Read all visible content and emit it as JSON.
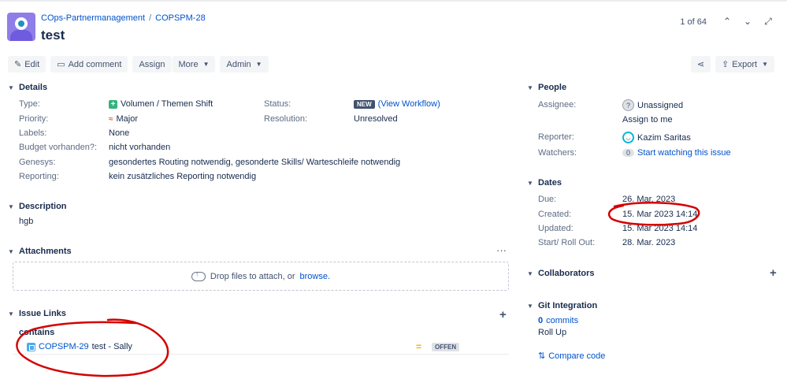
{
  "header": {
    "project": "COps-Partnermanagement",
    "issue_key": "COPSPM-28",
    "title": "test",
    "pager": "1 of 64"
  },
  "toolbar": {
    "edit": "Edit",
    "comment": "Add comment",
    "assign": "Assign",
    "more": "More",
    "admin": "Admin",
    "export": "Export"
  },
  "details": {
    "heading": "Details",
    "fields": [
      {
        "label": "Type:",
        "value": "Volumen / Themen Shift"
      },
      {
        "label": "Priority:",
        "value": "Major"
      },
      {
        "label": "Labels:",
        "value": "None"
      },
      {
        "label": "Budget vorhanden?:",
        "value": "nicht vorhanden"
      },
      {
        "label": "Genesys:",
        "value": "gesondertes Routing notwendig, gesonderte Skills/ Warteschleife notwendig"
      },
      {
        "label": "Reporting:",
        "value": "kein zusätzliches Reporting notwendig"
      }
    ],
    "status_label": "Status:",
    "status_value": "NEW",
    "workflow_open": "(",
    "workflow_link": "View Workflow",
    "workflow_close": ")",
    "resolution_label": "Resolution:",
    "resolution_value": "Unresolved"
  },
  "description": {
    "heading": "Description",
    "text": "hgb"
  },
  "attachments": {
    "heading": "Attachments",
    "drop_text": "Drop files to attach, or",
    "browse": "browse."
  },
  "issue_links": {
    "heading": "Issue Links",
    "relation": "contains",
    "key": "COPSPM-29",
    "summary": "test - Sally",
    "status": "OFFEN"
  },
  "people": {
    "heading": "People",
    "assignee_label": "Assignee:",
    "assignee_value": "Unassigned",
    "assign_to_me": "Assign to me",
    "reporter_label": "Reporter:",
    "reporter_value": "Kazim Saritas",
    "watchers_label": "Watchers:",
    "watchers_count": "0",
    "watch_link": "Start watching this issue"
  },
  "dates": {
    "heading": "Dates",
    "fields": [
      {
        "label": "Due:",
        "value": "26. Mar. 2023"
      },
      {
        "label": "Created:",
        "value": "15. Mar 2023 14:14"
      },
      {
        "label": "Updated:",
        "value": "15. Mar 2023 14:14"
      },
      {
        "label": "Start/ Roll Out:",
        "value": "28. Mar. 2023"
      }
    ]
  },
  "collaborators": {
    "heading": "Collaborators"
  },
  "git": {
    "heading": "Git Integration",
    "commits_count": "0",
    "commits_label": "commits",
    "rollup": "Roll Up",
    "compare": "Compare code"
  },
  "colors": {
    "accent": "#0052cc",
    "annotation": "#d40000"
  }
}
